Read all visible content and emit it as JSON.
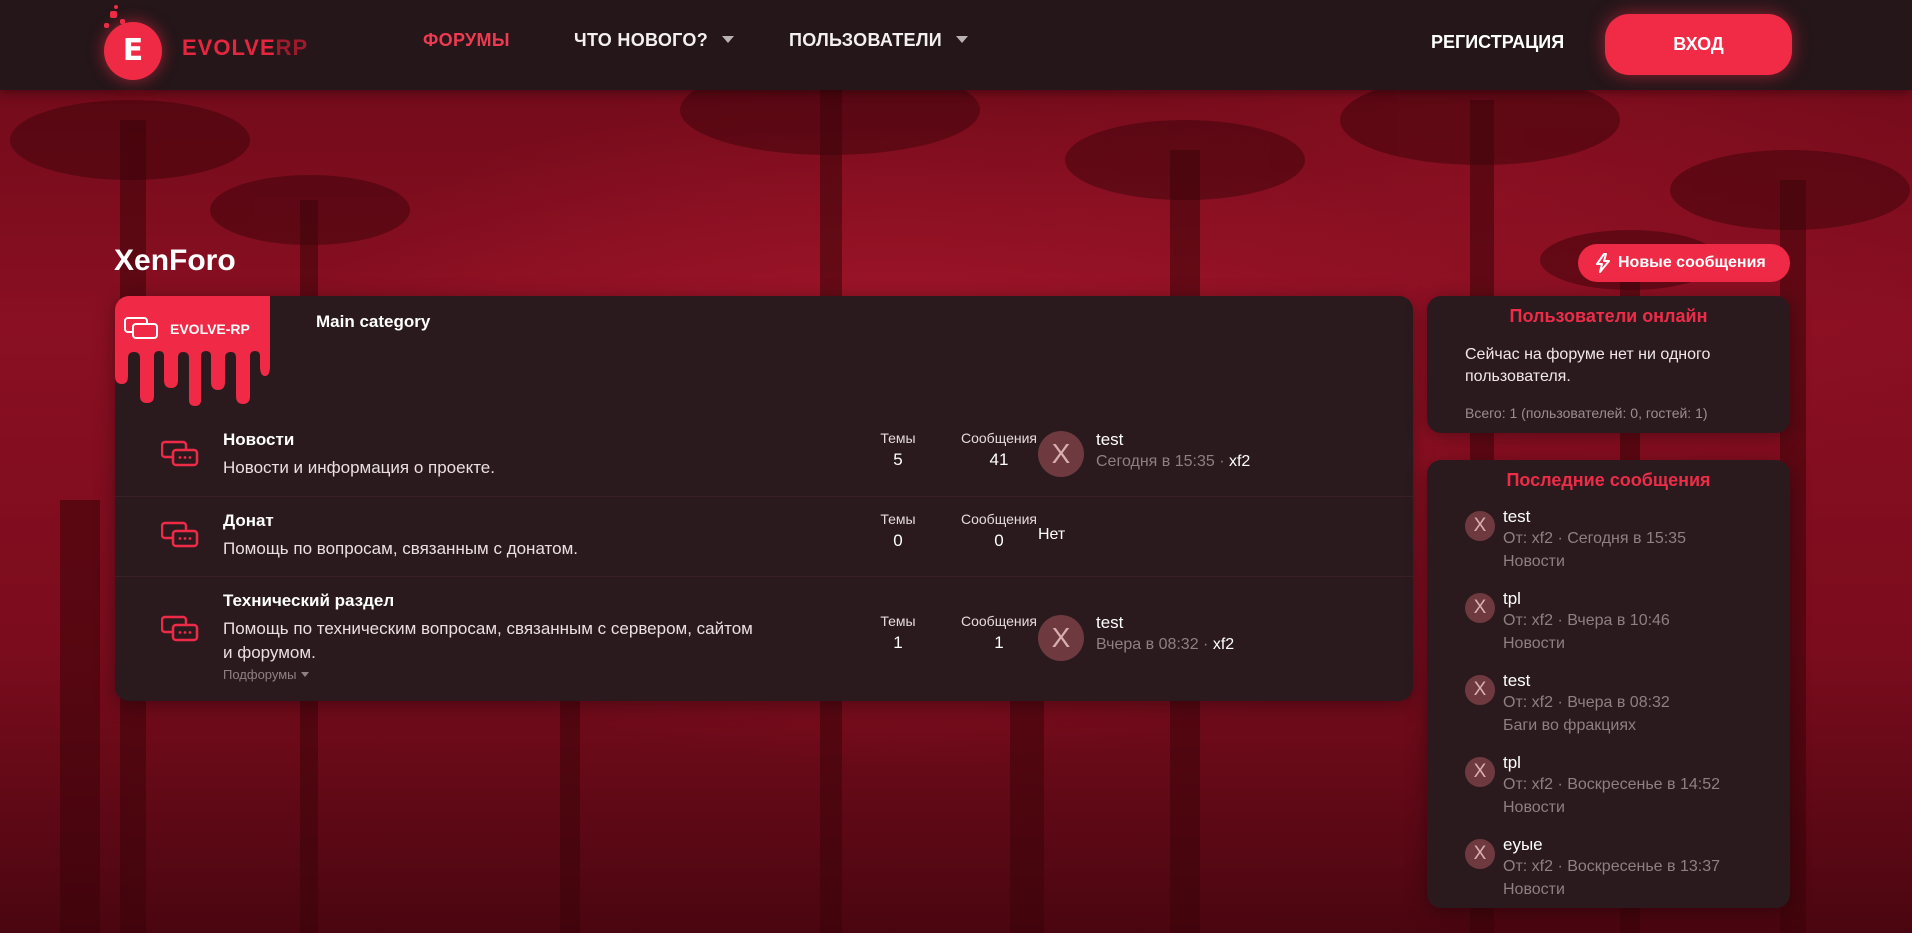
{
  "header": {
    "logo_main": "EVOLVE",
    "logo_accent": "RP",
    "logo_letter": "E",
    "nav": [
      {
        "label": "ФОРУМЫ",
        "active": true
      },
      {
        "label": "ЧТО НОВОГО?",
        "dropdown": true
      },
      {
        "label": "ПОЛЬЗОВАТЕЛИ",
        "dropdown": true
      }
    ],
    "register_label": "РЕГИСТРАЦИЯ",
    "login_label": "ВХОД"
  },
  "page": {
    "title": "XenForo",
    "new_posts_label": "Новые сообщения"
  },
  "category": {
    "banner_text": "EVOLVE-RP",
    "title": "Main category"
  },
  "nodes": [
    {
      "title": "Новости",
      "description": "Новости и информация о проекте.",
      "threads_label": "Темы",
      "threads": "5",
      "messages_label": "Сообщения",
      "messages": "41",
      "avatar_letter": "X",
      "last_title": "test",
      "last_time": "Сегодня в 15:35",
      "last_user": "xf2"
    },
    {
      "title": "Донат",
      "description": "Помощь по вопросам, связанным с донатом.",
      "threads_label": "Темы",
      "threads": "0",
      "messages_label": "Сообщения",
      "messages": "0",
      "none_label": "Нет"
    },
    {
      "title": "Технический раздел",
      "description_line1": "Помощь по техническим вопросам, связанным с сервером, сайтом",
      "description_line2": "и форумом.",
      "subforums_label": "Подфорумы",
      "threads_label": "Темы",
      "threads": "1",
      "messages_label": "Сообщения",
      "messages": "1",
      "avatar_letter": "X",
      "last_title": "test",
      "last_time": "Вчера в 08:32",
      "last_user": "xf2"
    }
  ],
  "sidebar": {
    "online": {
      "title": "Пользователи онлайн",
      "text": "Сейчас на форуме нет ни одного пользователя.",
      "footer": "Всего: 1 (пользователей: 0, гостей: 1)"
    },
    "latest": {
      "title": "Последние сообщения",
      "items": [
        {
          "avatar": "X",
          "title": "test",
          "meta": "От: xf2 · Сегодня в 15:35",
          "forum": "Новости"
        },
        {
          "avatar": "X",
          "title": "tpl",
          "meta": "От: xf2 · Вчера в 10:46",
          "forum": "Новости"
        },
        {
          "avatar": "X",
          "title": "test",
          "meta": "От: xf2 · Вчера в 08:32",
          "forum": "Баги во фракциях"
        },
        {
          "avatar": "X",
          "title": "tpl",
          "meta": "От: xf2 · Воскресенье в 14:52",
          "forum": "Новости"
        },
        {
          "avatar": "X",
          "title": "eyыe",
          "meta": "От: xf2 · Воскресенье в 13:37",
          "forum": "Новости"
        }
      ]
    }
  },
  "colors": {
    "accent": "#ef2a46",
    "panel": "#2a1a1e",
    "header": "#241619"
  },
  "icons": [
    "logo-drop-icon",
    "caret-down-icon",
    "bolt-icon",
    "forum-chat-icon"
  ]
}
